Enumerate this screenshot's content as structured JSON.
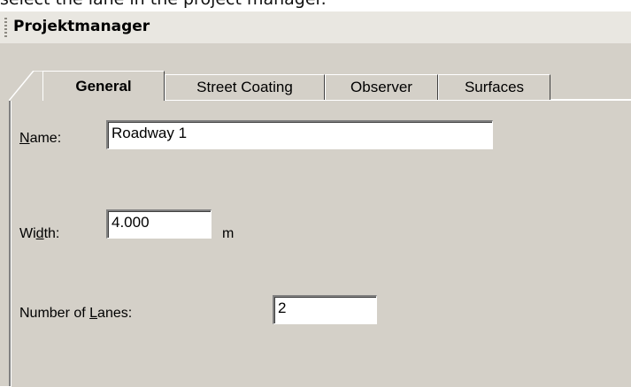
{
  "caption": "select the lane in the project manager.",
  "panel": {
    "title": "Projektmanager"
  },
  "tabs": [
    {
      "label": "General",
      "active": true
    },
    {
      "label": "Street Coating",
      "active": false
    },
    {
      "label": "Observer",
      "active": false
    },
    {
      "label": "Surfaces",
      "active": false
    }
  ],
  "form": {
    "name": {
      "label_mnemonic": "N",
      "label_rest": "ame:",
      "value": "Roadway 1"
    },
    "width": {
      "label_pre": "Wi",
      "label_mnemonic": "d",
      "label_post": "th:",
      "value": "4.000",
      "unit": "m"
    },
    "lanes": {
      "label_pre": "Number of ",
      "label_mnemonic": "L",
      "label_post": "anes:",
      "value": "2"
    }
  },
  "colors": {
    "panel_bg": "#d4d0c8",
    "titlebar_bg": "#e9e7e1"
  },
  "icons": [
    "grip-icon"
  ]
}
